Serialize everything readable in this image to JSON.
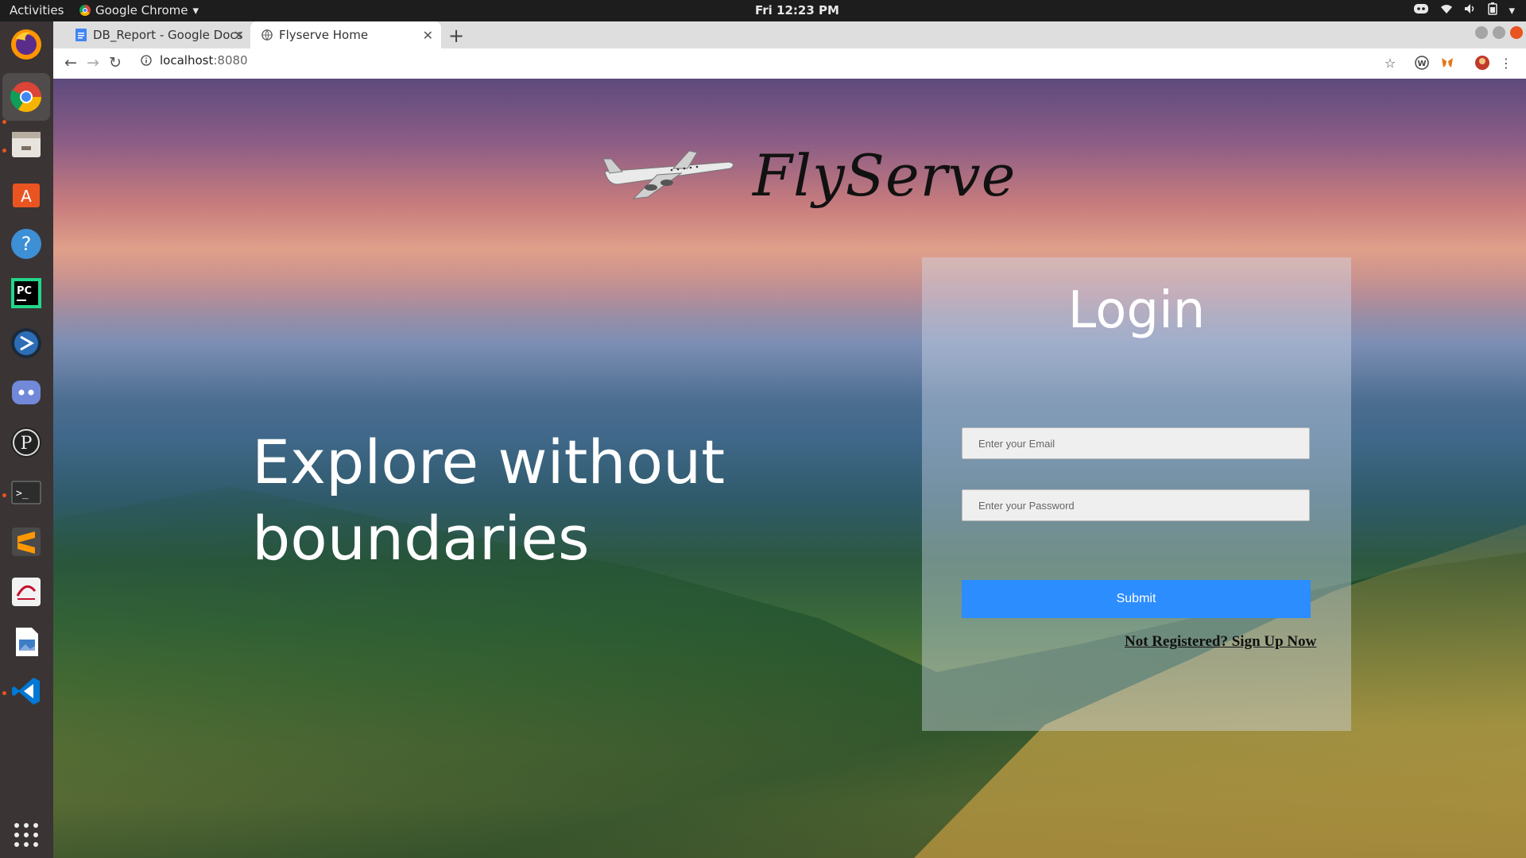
{
  "system": {
    "activities_label": "Activities",
    "app_menu_label": "Google Chrome",
    "clock": "Fri 12:23 PM"
  },
  "dock": {
    "items": [
      "firefox-icon",
      "chrome-icon",
      "files-icon",
      "software-center-icon",
      "help-icon",
      "pycharm-icon",
      "bluetooth-app-icon",
      "discord-icon",
      "pgadmin-icon",
      "terminal-icon",
      "sublime-text-icon",
      "eclipse-icon",
      "image-viewer-icon",
      "vscode-icon",
      "show-apps-icon"
    ]
  },
  "browser": {
    "tabs": [
      {
        "label": "DB_Report - Google Docs",
        "active": false
      },
      {
        "label": "Flyserve Home",
        "active": true
      }
    ],
    "url_host": "localhost",
    "url_port": ":8080"
  },
  "page": {
    "brand": "FlyServe",
    "hero_line1": "Explore without",
    "hero_line2": "boundaries",
    "login": {
      "title": "Login",
      "email_placeholder": "Enter your Email",
      "password_placeholder": "Enter your Password",
      "submit_label": "Submit",
      "signup_link": "Not Registered? Sign Up Now"
    }
  },
  "colors": {
    "submit_bg": "#2c8dff",
    "ubuntu_accent": "#e95420"
  }
}
